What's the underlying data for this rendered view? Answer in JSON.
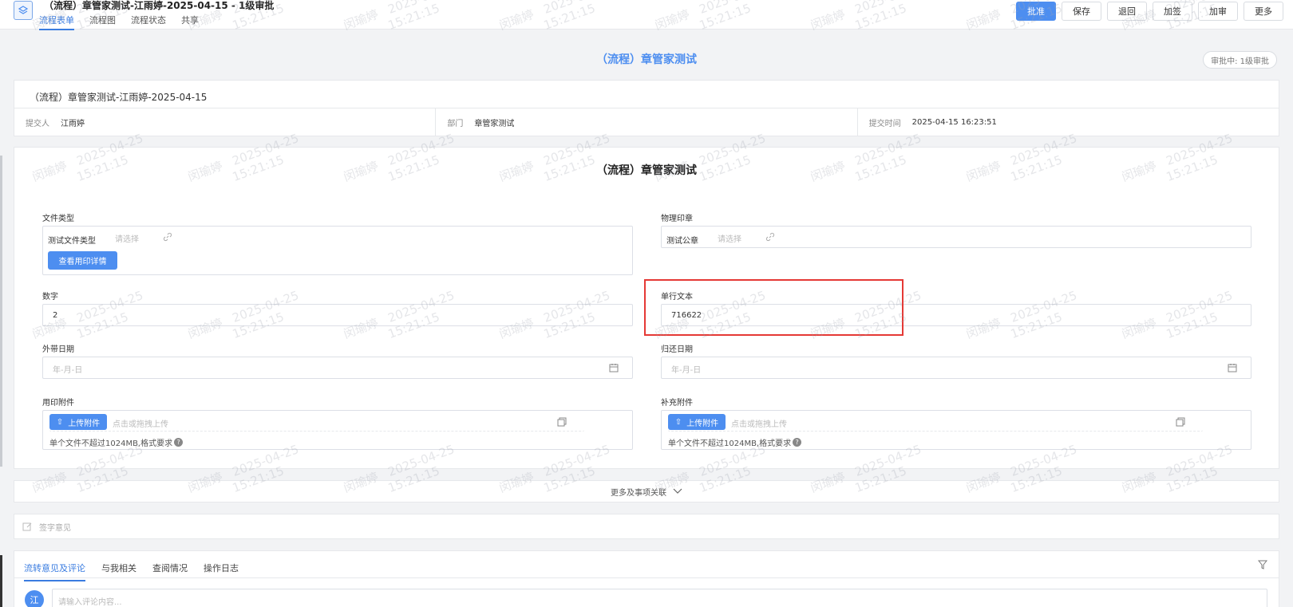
{
  "header": {
    "title": "（流程）章管家测试-江雨婷-2025-04-15 - 1级审批",
    "tabs": [
      {
        "label": "流程表单",
        "active": true
      },
      {
        "label": "流程图",
        "active": false
      },
      {
        "label": "流程状态",
        "active": false
      },
      {
        "label": "共享",
        "active": false
      }
    ],
    "actions": {
      "approve": "批准",
      "save": "保存",
      "return": "退回",
      "add_sign": "加签",
      "add_review": "加审",
      "more": "更多"
    }
  },
  "form_heading": "（流程）章管家测试",
  "status_pill": "审批中: 1级审批",
  "info": {
    "title": "（流程）章管家测试-江雨婷-2025-04-15",
    "submitter_label": "提交人",
    "submitter": "江雨婷",
    "dept_label": "部门",
    "dept": "章管家测试",
    "time_label": "提交时间",
    "time": "2025-04-15 16:23:51"
  },
  "form": {
    "title": "（流程）章管家测试",
    "file_type": {
      "label": "文件类型",
      "value": "测试文件类型",
      "placeholder": "请选择",
      "detail_button": "查看用印详情"
    },
    "physical_seal": {
      "label": "物理印章",
      "value": "测试公章",
      "placeholder": "请选择"
    },
    "number": {
      "label": "数字",
      "value": "2"
    },
    "single_text": {
      "label": "单行文本",
      "value": "716622"
    },
    "out_date": {
      "label": "外带日期",
      "placeholder": "年-月-日"
    },
    "return_date": {
      "label": "归还日期",
      "placeholder": "年-月-日"
    },
    "seal_attach": {
      "label": "用印附件",
      "upload_button": "上传附件",
      "placeholder": "点击或拖拽上传",
      "hint": "单个文件不超过1024MB,格式要求"
    },
    "extra_attach": {
      "label": "补充附件",
      "upload_button": "上传附件",
      "placeholder": "点击或拖拽上传",
      "hint": "单个文件不超过1024MB,格式要求"
    },
    "qmark": "?"
  },
  "more_bar": "更多及事项关联",
  "sign_bar": "签字意见",
  "bottom": {
    "tabs": [
      {
        "label": "流转意见及评论",
        "active": true
      },
      {
        "label": "与我相关",
        "active": false
      },
      {
        "label": "查阅情况",
        "active": false
      },
      {
        "label": "操作日志",
        "active": false
      }
    ],
    "avatar": "江",
    "comment_placeholder": "请输入评论内容..."
  },
  "watermark": {
    "name": "闵瑜婷",
    "date": "2025-04-25",
    "time": "15:21:15"
  },
  "colors": {
    "accent": "#4d8ef0",
    "highlight": "#e53935"
  }
}
